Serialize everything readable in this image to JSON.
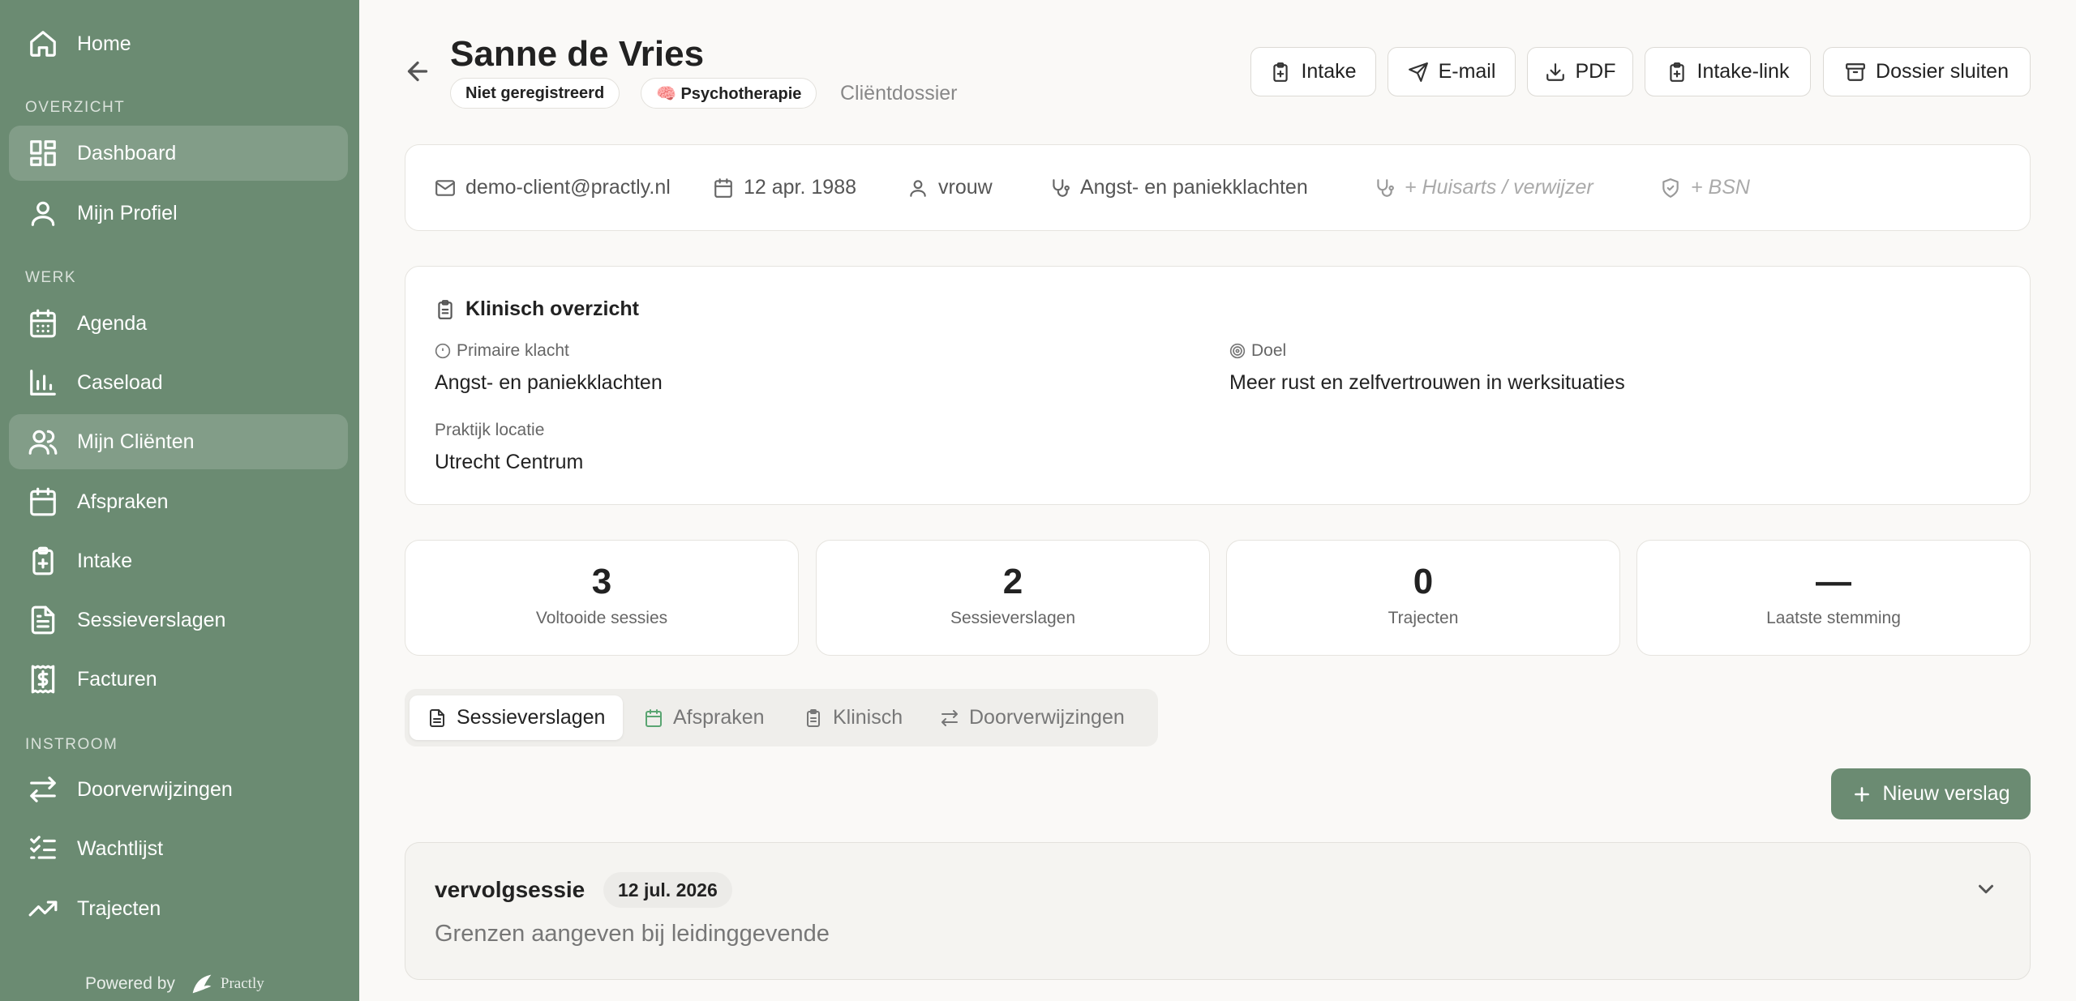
{
  "sidebar": {
    "home": "Home",
    "section_overview": "OVERZICHT",
    "dashboard": "Dashboard",
    "profile": "Mijn Profiel",
    "section_work": "WERK",
    "agenda": "Agenda",
    "caseload": "Caseload",
    "clients": "Mijn Cliënten",
    "appointments": "Afspraken",
    "intake": "Intake",
    "reports": "Sessieverslagen",
    "invoices": "Facturen",
    "section_inflow": "INSTROOM",
    "referrals": "Doorverwijzingen",
    "waitlist": "Wachtlijst",
    "trajectories": "Trajecten",
    "powered_by": "Powered by",
    "brand": "Practly"
  },
  "header": {
    "client_name": "Sanne de Vries",
    "badge_status": "Niet geregistreerd",
    "badge_type": "🧠 Psychotherapie",
    "dossier_label": "Cliëntdossier",
    "buttons": {
      "intake": "Intake",
      "email": "E-mail",
      "pdf": "PDF",
      "intake_link": "Intake-link",
      "close": "Dossier sluiten"
    }
  },
  "info": {
    "email": "demo-client@practly.nl",
    "dob": "12 apr. 1988",
    "gender": "vrouw",
    "complaint": "Angst- en paniekklachten",
    "gp_placeholder": "+ Huisarts / verwijzer",
    "bsn_placeholder": "+ BSN"
  },
  "clinical": {
    "title": "Klinisch overzicht",
    "primary_label": "Primaire klacht",
    "primary_value": "Angst- en paniekklachten",
    "goal_label": "Doel",
    "goal_value": "Meer rust en zelfvertrouwen in werksituaties",
    "location_label": "Praktijk locatie",
    "location_value": "Utrecht Centrum"
  },
  "stats": [
    {
      "value": "3",
      "label": "Voltooide sessies"
    },
    {
      "value": "2",
      "label": "Sessieverslagen"
    },
    {
      "value": "0",
      "label": "Trajecten"
    },
    {
      "value": "—",
      "label": "Laatste stemming"
    }
  ],
  "tabs": {
    "reports": "Sessieverslagen",
    "appointments": "Afspraken",
    "clinical": "Klinisch",
    "referrals": "Doorverwijzingen"
  },
  "new_report": "Nieuw verslag",
  "report": {
    "type": "vervolgsessie",
    "date": "12 jul. 2026",
    "summary": "Grenzen aangeven bij leidinggevende"
  },
  "colors": {
    "sidebar": "#6b8b72",
    "accent": "#6b8b72",
    "background": "#faf9f7"
  }
}
